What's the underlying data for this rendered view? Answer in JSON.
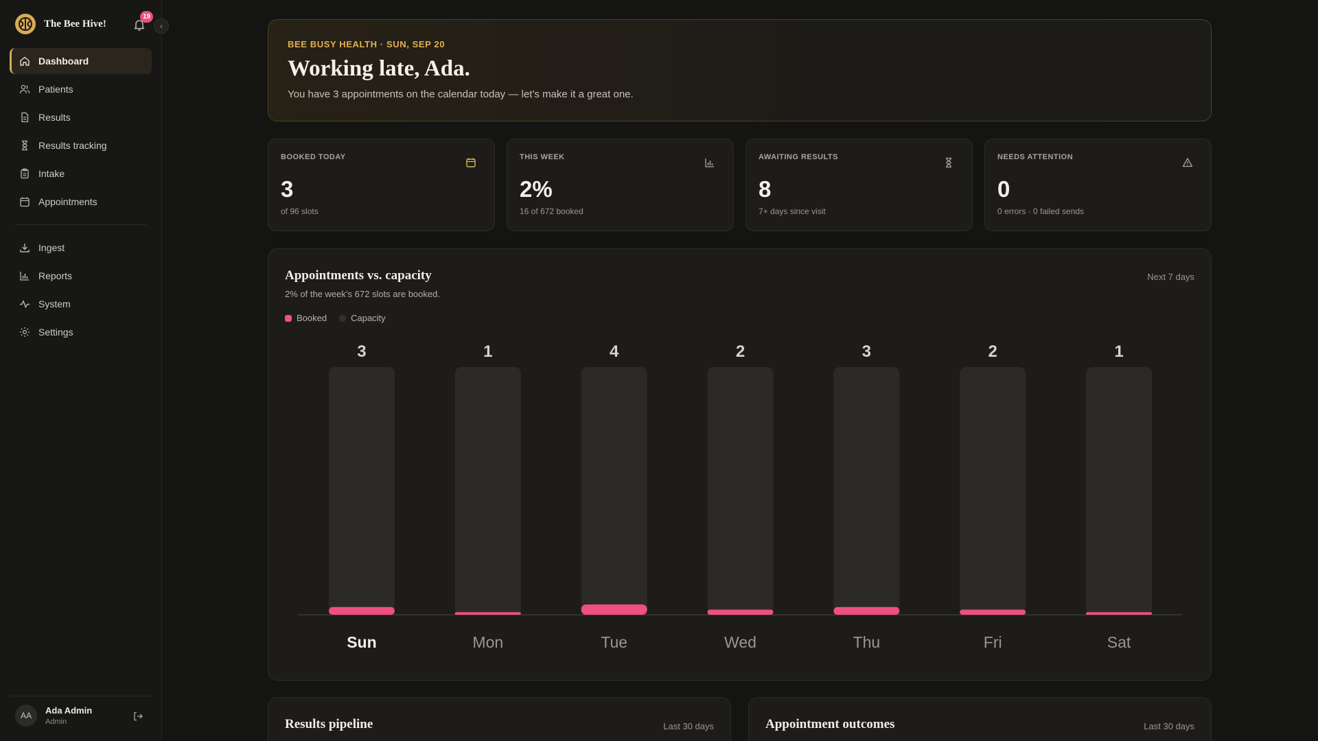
{
  "app": {
    "name": "The Bee Hive!",
    "notification_count": "19"
  },
  "sidebar": {
    "primary": [
      {
        "label": "Dashboard",
        "icon": "home-icon",
        "active": true
      },
      {
        "label": "Patients",
        "icon": "users-icon"
      },
      {
        "label": "Results",
        "icon": "file-icon"
      },
      {
        "label": "Results tracking",
        "icon": "hourglass-icon"
      },
      {
        "label": "Intake",
        "icon": "clipboard-icon"
      },
      {
        "label": "Appointments",
        "icon": "calendar-icon"
      }
    ],
    "secondary": [
      {
        "label": "Ingest",
        "icon": "download-icon"
      },
      {
        "label": "Reports",
        "icon": "bar-chart-icon"
      },
      {
        "label": "System",
        "icon": "activity-icon"
      },
      {
        "label": "Settings",
        "icon": "gear-icon"
      }
    ]
  },
  "user": {
    "initials": "AA",
    "name": "Ada Admin",
    "role": "Admin"
  },
  "hero": {
    "eyebrow": "BEE BUSY HEALTH · SUN, SEP 20",
    "title": "Working late, Ada.",
    "subtitle": "You have 3 appointments on the calendar today — let’s make it a great one."
  },
  "stats": [
    {
      "label": "BOOKED TODAY",
      "value": "3",
      "sub": "of 96 slots",
      "icon": "calendar-icon"
    },
    {
      "label": "THIS WEEK",
      "value": "2%",
      "sub": "16 of 672 booked",
      "icon": "bar-chart-icon"
    },
    {
      "label": "AWAITING RESULTS",
      "value": "8",
      "sub": "7+ days since visit",
      "icon": "hourglass-icon"
    },
    {
      "label": "NEEDS ATTENTION",
      "value": "0",
      "sub": "0 errors · 0 failed sends",
      "icon": "alert-triangle-icon"
    }
  ],
  "chart_card": {
    "title": "Appointments vs. capacity",
    "subtitle": "2% of the week’s 672 slots are booked.",
    "range": "Next 7 days"
  },
  "chart_data": {
    "type": "bar",
    "categories": [
      "Sun",
      "Mon",
      "Tue",
      "Wed",
      "Thu",
      "Fri",
      "Sat"
    ],
    "series": [
      {
        "name": "Booked",
        "values": [
          3,
          1,
          4,
          2,
          3,
          2,
          1
        ],
        "color": "#ef4f81"
      },
      {
        "name": "Capacity",
        "values": [
          96,
          96,
          96,
          96,
          96,
          96,
          96
        ],
        "color": "#2b2a27"
      }
    ],
    "highlight_category": "Sun",
    "ylim": [
      0,
      96
    ]
  },
  "bottom_cards": [
    {
      "title": "Results pipeline",
      "range": "Last 30 days"
    },
    {
      "title": "Appointment outcomes",
      "range": "Last 30 days"
    }
  ],
  "colors": {
    "accent": "#d7ac55",
    "booked": "#ef4f81",
    "capacity": "#2b2a27"
  }
}
